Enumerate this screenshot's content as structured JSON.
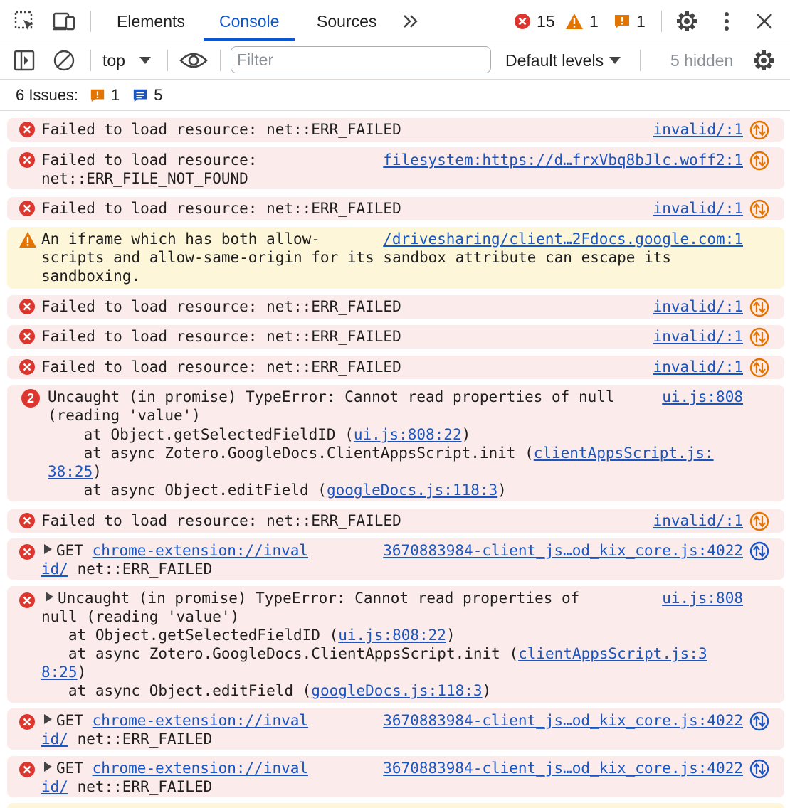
{
  "tabs": {
    "elements": "Elements",
    "console": "Console",
    "sources": "Sources",
    "more": "»"
  },
  "counters": {
    "errors": "15",
    "warnings": "1",
    "issues": "1"
  },
  "toolbar": {
    "context": "top",
    "filter_placeholder": "Filter",
    "levels": "Default levels",
    "hidden": "5 hidden"
  },
  "issues_bar": {
    "label": "6 Issues:",
    "warning_count": "1",
    "info_count": "5"
  },
  "colors": {
    "error": "#dc362e",
    "warning": "#e37400",
    "link": "#1a56c2",
    "accent": "#0b57d0",
    "error_bg": "#fcebeb",
    "warning_bg": "#fdf6d8"
  },
  "messages": [
    {
      "type": "error",
      "lines": [
        "Failed to load resource: net::ERR_FAILED"
      ],
      "source": "invalid/:1",
      "icon": "network-request-icon"
    },
    {
      "type": "error",
      "lines": [
        "Failed to load resource:",
        "net::ERR_FILE_NOT_FOUND"
      ],
      "source": "filesystem:https://d…frxVbq8bJlc.woff2:1",
      "icon": "network-request-icon"
    },
    {
      "type": "error",
      "lines": [
        "Failed to load resource: net::ERR_FAILED"
      ],
      "source": "invalid/:1",
      "icon": "network-request-icon"
    },
    {
      "type": "warning",
      "lines": [
        "An iframe which has both allow-",
        "scripts and allow-same-origin for its sandbox attribute can escape its",
        "sandboxing."
      ],
      "source": "/drivesharing/client…2Fdocs.google.com:1"
    },
    {
      "type": "error",
      "lines": [
        "Failed to load resource: net::ERR_FAILED"
      ],
      "source": "invalid/:1",
      "icon": "network-request-icon"
    },
    {
      "type": "error",
      "lines": [
        "Failed to load resource: net::ERR_FAILED"
      ],
      "source": "invalid/:1",
      "icon": "network-request-icon"
    },
    {
      "type": "error",
      "lines": [
        "Failed to load resource: net::ERR_FAILED"
      ],
      "source": "invalid/:1",
      "icon": "network-request-icon"
    },
    {
      "type": "error",
      "repeat": "2",
      "head": [
        "Uncaught (in promise) TypeError: Cannot read properties of null",
        "(reading 'value')"
      ],
      "source": "ui.js:808",
      "stack": {
        "l1_pre": "    at Object.getSelectedFieldID (",
        "l1_link": "ui.js:808:22",
        "l1_post": ")",
        "l2_pre": "    at async Zotero.GoogleDocs.ClientAppsScript.init (",
        "l2_link_a": "clientAppsScript.js:",
        "l2_link_b": "38:25",
        "l2_post": ")",
        "l3_pre": "    at async Object.editField (",
        "l3_link": "googleDocs.js:118:3",
        "l3_post": ")"
      }
    },
    {
      "type": "error",
      "lines": [
        "Failed to load resource: net::ERR_FAILED"
      ],
      "source": "invalid/:1",
      "icon": "network-request-icon"
    },
    {
      "type": "error",
      "get": {
        "method": "GET",
        "url_a": "chrome-extension://inval",
        "url_b": "id/",
        "status": "net::ERR_FAILED"
      },
      "source": "3670883984-client_js…od_kix_core.js:4022"
    },
    {
      "type": "error",
      "head": [
        "Uncaught (in promise) TypeError: Cannot read properties of",
        "null (reading 'value')"
      ],
      "source": "ui.js:808",
      "stack": {
        "l1_pre": "   at Object.getSelectedFieldID (",
        "l1_link": "ui.js:808:22",
        "l1_post": ")",
        "l2_pre": "   at async Zotero.GoogleDocs.ClientAppsScript.init (",
        "l2_link_a": "clientAppsScript.js:3",
        "l2_link_b": "8:25",
        "l2_post": ")",
        "l3_pre": "   at async Object.editField (",
        "l3_link": "googleDocs.js:118:3",
        "l3_post": ")"
      }
    },
    {
      "type": "error",
      "get": {
        "method": "GET",
        "url_a": "chrome-extension://inval",
        "url_b": "id/",
        "status": "net::ERR_FAILED"
      },
      "source": "3670883984-client_js…od_kix_core.js:4022"
    },
    {
      "type": "error",
      "get": {
        "method": "GET",
        "url_a": "chrome-extension://inval",
        "url_b": "id/",
        "status": "net::ERR_FAILED"
      },
      "source": "3670883984-client_js…od_kix_core.js:4022"
    }
  ]
}
